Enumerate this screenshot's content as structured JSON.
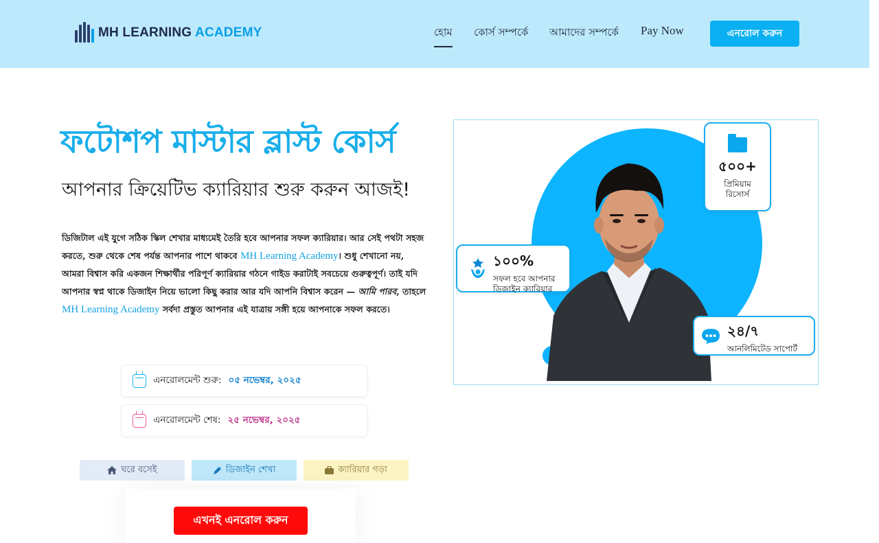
{
  "header": {
    "logo_prefix": "MH LEARNING",
    "logo_suffix": "ACADEMY",
    "nav": [
      {
        "label": "হোম",
        "active": true
      },
      {
        "label": "কোর্স সম্পর্কে"
      },
      {
        "label": "আমাদের সম্পর্কে"
      },
      {
        "label": "Pay Now"
      }
    ],
    "enroll_label": "এনরোল করুন"
  },
  "hero": {
    "title": "ফটোশপ মাস্টার ব্লাস্ট কোর্স",
    "subtitle": "আপনার ক্রিয়েটিভ ক্যারিয়ার শুরু করুন আজই!",
    "paragraph": {
      "p1": "ডিজিটাল এই যুগে সঠিক স্কিল শেখার মাধ্যমেই তৈরি হবে আপনার সফল ক্যারিয়ার। আর সেই পথটা সহজ করতে, শুরু থেকে শেষ পর্যন্ত আপনার পাশে থাকবে ",
      "brand1": "MH Learning Academy",
      "p2": "। শুধু শেখানো নয়, আমরা বিশ্বাস করি একজন শিক্ষার্থীর পরিপূর্ণ ক্যারিয়ার গঠনে গাইড করাটাই সবচেয়ে গুরুত্বপূর্ণ। তাই যদি আপনার স্বপ্ন থাকে ডিজাইন নিয়ে ভালো কিছু করার আর যদি আপনি বিশ্বাস করেন — ",
      "quote": "আমি পারব",
      "p3": ", তাহলে ",
      "brand2": "MH Learning Academy",
      "p4": " সর্বদা প্রস্তুত আপনার এই যাত্রায় সঙ্গী হয়ে আপনাকে সফল করতে।"
    }
  },
  "enrollment": {
    "start_label": "এনরোলমেন্ট শুরু:",
    "start_value": "০৫ নভেম্বর, ২০২৫",
    "end_label": "এনরোলমেন্ট শেষ:",
    "end_value": "২৫ নভেম্বর, ২০২৫"
  },
  "tags": {
    "home": "ঘরে বসেই",
    "design": "ডিজাইন শেখা",
    "career": "ক্যারিয়ার গড়া"
  },
  "cta_label": "এখনই এনরোল করুন",
  "stats": {
    "resources_value": "৫০০+",
    "resources_label_1": "প্রিমিয়াম",
    "resources_label_2": "রিসোর্স",
    "success_value": "১০০%",
    "success_label_1": "সফল হবে আপনার",
    "success_label_2": "ডিজাইন ক্যারিয়ার",
    "support_value": "২৪/৭",
    "support_label": "আনলিমিটেড সাপোর্ট"
  },
  "colors": {
    "header_bg": "#bde9fd",
    "accent": "#19aeea",
    "cta": "#ff0a0a"
  }
}
